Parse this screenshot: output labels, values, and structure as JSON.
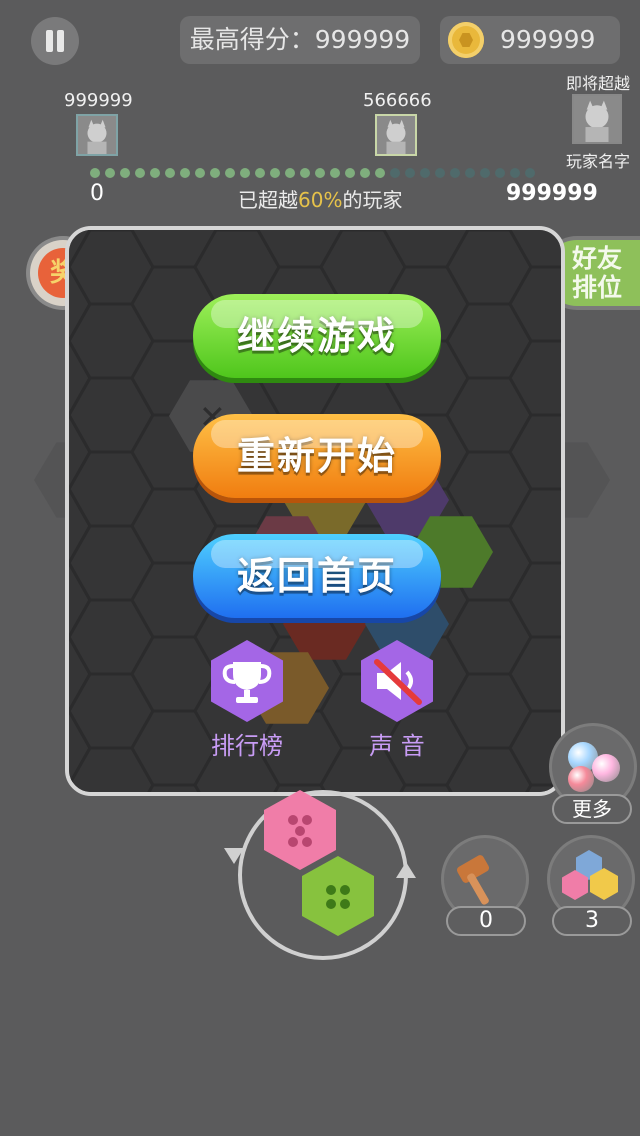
{
  "top": {
    "best_label": "最高得分：999999",
    "coins": "999999"
  },
  "progress": {
    "left_score": "999999",
    "mid_score": "566666",
    "next_label": "即将超越",
    "next_name": "玩家名字",
    "start": "0",
    "end": "999999",
    "percent_prefix": "已超越",
    "percent": "60%",
    "percent_suffix": "的玩家",
    "fill_fraction": 0.66
  },
  "side": {
    "reward": "奖",
    "friends_line1": "好友",
    "friends_line2": "排位"
  },
  "menu": {
    "continue": "继续游戏",
    "restart": "重新开始",
    "home": "返回首页",
    "rank": "排行榜",
    "sound": "声 音"
  },
  "tools": {
    "more": "更多",
    "hammer_count": "0",
    "blocks_count": "3"
  },
  "colors": {
    "green": "#4fc61c",
    "orange": "#f07d10",
    "blue": "#1f6ff0",
    "purple": "#a466e6",
    "accent": "#e9b83b"
  }
}
